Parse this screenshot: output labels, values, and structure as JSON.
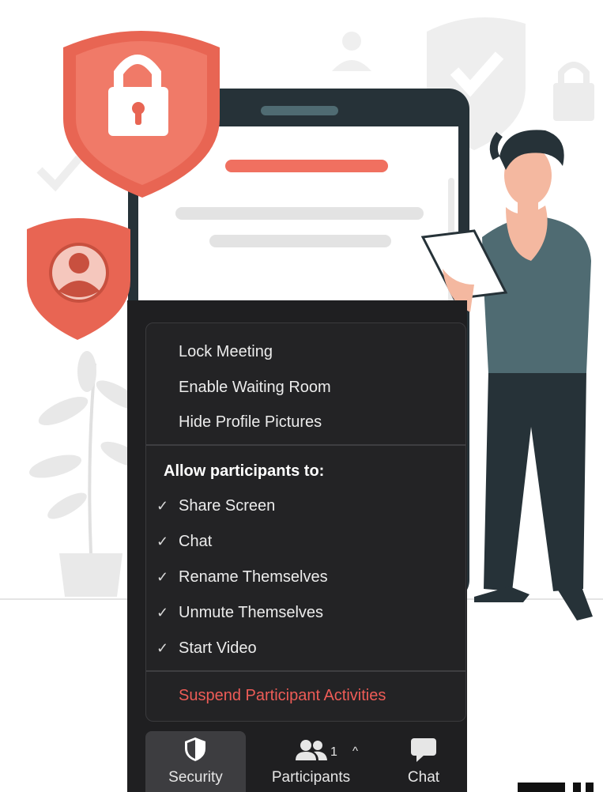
{
  "menu": {
    "items": [
      {
        "label": "Lock Meeting"
      },
      {
        "label": "Enable Waiting Room"
      },
      {
        "label": "Hide Profile Pictures"
      }
    ],
    "allow_heading": "Allow participants to:",
    "allow_items": [
      {
        "label": "Share Screen",
        "checked": true
      },
      {
        "label": "Chat",
        "checked": true
      },
      {
        "label": "Rename Themselves",
        "checked": true
      },
      {
        "label": "Unmute Themselves",
        "checked": true
      },
      {
        "label": "Start Video",
        "checked": true
      }
    ],
    "check_glyph": "✓",
    "suspend_label": "Suspend Participant Activities"
  },
  "toolbar": {
    "security_label": "Security",
    "participants_label": "Participants",
    "participant_count": "1",
    "caret": "^",
    "chat_label": "Chat"
  },
  "icons": {
    "security": "shield-icon",
    "participants": "people-icon",
    "chat": "speech-bubble-icon",
    "lock": "lock-icon",
    "user": "user-icon"
  },
  "colors": {
    "accent": "#f07060",
    "suspend": "#ee5c57",
    "panel": "#1f1f21",
    "device": "#263238"
  }
}
